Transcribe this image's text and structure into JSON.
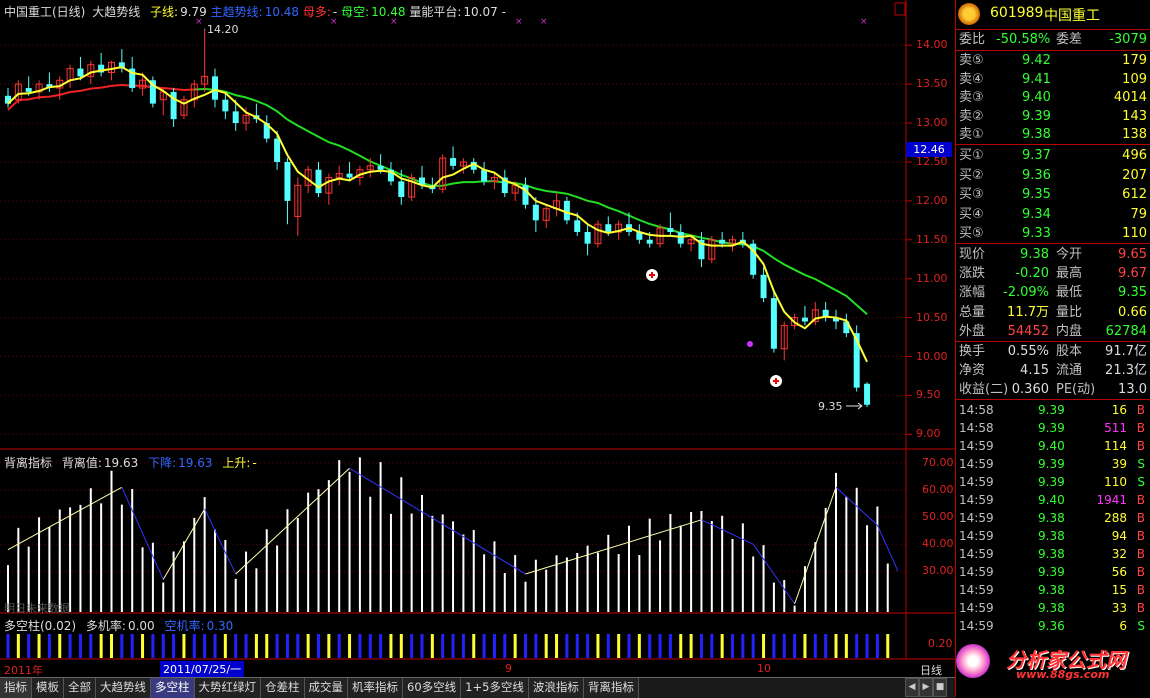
{
  "header": {
    "title": "中国重工(日线)",
    "indicator": "大趋势线",
    "sub_label": "子线:",
    "sub_val": "9.79",
    "main_label": "主趋势线:",
    "main_val": "10.48",
    "mother_label": "母多:",
    "mother_val": "-",
    "mokong_label": "母空:",
    "mokong_val": "10.48",
    "power_label": "量能平台:",
    "power_val": "10.07",
    "power_extra": "-"
  },
  "price_axis": [
    "14.00",
    "13.50",
    "13.00",
    "12.50",
    "12.00",
    "11.50",
    "11.00",
    "10.50",
    "10.00",
    "9.50",
    "9.00"
  ],
  "price_marker": "12.46",
  "high_label": "14.20",
  "low_label": "9.35",
  "sub_header": {
    "name": "背离指标",
    "val_label": "背离值:",
    "val": "19.63",
    "down_label": "下降:",
    "down_val": "19.63",
    "up_label": "上升:",
    "up_val": "-"
  },
  "sub_axis": [
    "70.00",
    "60.00",
    "50.00",
    "40.00",
    "30.00"
  ],
  "sub_watermark": "明日未来数据",
  "dk_header": {
    "name": "多空柱(0.02)",
    "duo_label": "多机率:",
    "duo_val": "0.00",
    "kong_label": "空机率:",
    "kong_val": "0.30"
  },
  "dk_axis": "0.20",
  "date_axis": {
    "year": "2011年",
    "cursor": "2011/07/25/一",
    "m9": "9",
    "m10": "10",
    "period": "日线"
  },
  "tabs": [
    "指标",
    "模板",
    "全部",
    "大趋势线",
    "多空柱",
    "大势红绿灯",
    "仓差柱",
    "成交量",
    "机率指标",
    "60多空线",
    "1+5多空线",
    "波浪指标",
    "背离指标"
  ],
  "active_tab": "多空柱",
  "quote": {
    "code": "601989",
    "name": "中国重工",
    "weibi_label": "委比",
    "weibi": "-50.58%",
    "weicha_label": "委差",
    "weicha": "-3079",
    "asks": [
      {
        "label": "卖⑤",
        "price": "9.42",
        "vol": "179"
      },
      {
        "label": "卖④",
        "price": "9.41",
        "vol": "109"
      },
      {
        "label": "卖③",
        "price": "9.40",
        "vol": "4014"
      },
      {
        "label": "卖②",
        "price": "9.39",
        "vol": "143"
      },
      {
        "label": "卖①",
        "price": "9.38",
        "vol": "138"
      }
    ],
    "bids": [
      {
        "label": "买①",
        "price": "9.37",
        "vol": "496"
      },
      {
        "label": "买②",
        "price": "9.36",
        "vol": "207"
      },
      {
        "label": "买③",
        "price": "9.35",
        "vol": "612"
      },
      {
        "label": "买④",
        "price": "9.34",
        "vol": "79"
      },
      {
        "label": "买⑤",
        "price": "9.33",
        "vol": "110"
      }
    ],
    "stats": [
      {
        "l1": "现价",
        "v1": "9.38",
        "c1": "#3f3",
        "l2": "今开",
        "v2": "9.65",
        "c2": "#f44"
      },
      {
        "l1": "涨跌",
        "v1": "-0.20",
        "c1": "#3f3",
        "l2": "最高",
        "v2": "9.67",
        "c2": "#f44"
      },
      {
        "l1": "涨幅",
        "v1": "-2.09%",
        "c1": "#3f3",
        "l2": "最低",
        "v2": "9.35",
        "c2": "#3f3"
      },
      {
        "l1": "总量",
        "v1": "11.7万",
        "c1": "#ff3",
        "l2": "量比",
        "v2": "0.66",
        "c2": "#ff3"
      },
      {
        "l1": "外盘",
        "v1": "54452",
        "c1": "#f44",
        "l2": "内盘",
        "v2": "62784",
        "c2": "#3f3"
      }
    ],
    "stats2": [
      {
        "l1": "换手",
        "v1": "0.55%",
        "l2": "股本",
        "v2": "91.7亿"
      },
      {
        "l1": "净资",
        "v1": "4.15",
        "l2": "流通",
        "v2": "21.3亿"
      },
      {
        "l1": "收益(二)",
        "v1": "0.360",
        "l2": "PE(动)",
        "v2": "13.0"
      }
    ],
    "ticks": [
      {
        "t": "14:58",
        "p": "9.39",
        "v": "16",
        "vc": "#ff3",
        "s": "B"
      },
      {
        "t": "14:58",
        "p": "9.39",
        "v": "511",
        "vc": "#f3f",
        "s": "B"
      },
      {
        "t": "14:59",
        "p": "9.40",
        "v": "114",
        "vc": "#ff3",
        "s": "B"
      },
      {
        "t": "14:59",
        "p": "9.39",
        "v": "39",
        "vc": "#ff3",
        "s": "S"
      },
      {
        "t": "14:59",
        "p": "9.39",
        "v": "110",
        "vc": "#ff3",
        "s": "S"
      },
      {
        "t": "14:59",
        "p": "9.40",
        "v": "1941",
        "vc": "#f3f",
        "s": "B"
      },
      {
        "t": "14:59",
        "p": "9.38",
        "v": "288",
        "vc": "#ff3",
        "s": "B"
      },
      {
        "t": "14:59",
        "p": "9.38",
        "v": "94",
        "vc": "#ff3",
        "s": "B"
      },
      {
        "t": "14:59",
        "p": "9.38",
        "v": "32",
        "vc": "#ff3",
        "s": "B"
      },
      {
        "t": "14:59",
        "p": "9.39",
        "v": "56",
        "vc": "#ff3",
        "s": "B"
      },
      {
        "t": "14:59",
        "p": "9.38",
        "v": "15",
        "vc": "#ff3",
        "s": "B"
      },
      {
        "t": "14:59",
        "p": "9.38",
        "v": "33",
        "vc": "#ff3",
        "s": "B"
      },
      {
        "t": "14:59",
        "p": "9.36",
        "v": "6",
        "vc": "#ff3",
        "s": "S"
      }
    ]
  },
  "watermark": {
    "brand": "分析家公式网",
    "url": "www.88gs.com"
  },
  "chart_data": {
    "type": "candlestick",
    "price_range": [
      8.85,
      14.35
    ],
    "candles": [
      [
        13.35,
        13.45,
        13.2,
        13.25
      ],
      [
        13.3,
        13.55,
        13.25,
        13.5
      ],
      [
        13.45,
        13.6,
        13.35,
        13.4
      ],
      [
        13.4,
        13.55,
        13.3,
        13.5
      ],
      [
        13.5,
        13.65,
        13.4,
        13.45
      ],
      [
        13.45,
        13.6,
        13.3,
        13.55
      ],
      [
        13.55,
        13.75,
        13.45,
        13.7
      ],
      [
        13.7,
        13.85,
        13.55,
        13.6
      ],
      [
        13.6,
        13.8,
        13.5,
        13.75
      ],
      [
        13.75,
        13.9,
        13.6,
        13.65
      ],
      [
        13.65,
        13.8,
        13.55,
        13.78
      ],
      [
        13.78,
        13.95,
        13.65,
        13.7
      ],
      [
        13.7,
        13.85,
        13.4,
        13.45
      ],
      [
        13.45,
        13.65,
        13.35,
        13.55
      ],
      [
        13.55,
        13.6,
        13.2,
        13.25
      ],
      [
        13.3,
        13.45,
        13.1,
        13.4
      ],
      [
        13.4,
        13.45,
        12.95,
        13.05
      ],
      [
        13.1,
        13.35,
        13.05,
        13.3
      ],
      [
        13.3,
        13.55,
        13.2,
        13.5
      ],
      [
        13.5,
        14.2,
        13.4,
        13.6
      ],
      [
        13.6,
        13.7,
        13.2,
        13.3
      ],
      [
        13.3,
        13.4,
        13.05,
        13.15
      ],
      [
        13.15,
        13.3,
        12.9,
        13.0
      ],
      [
        13.0,
        13.2,
        12.9,
        13.1
      ],
      [
        13.1,
        13.25,
        13.0,
        13.05
      ],
      [
        13.0,
        13.1,
        12.75,
        12.8
      ],
      [
        12.8,
        12.9,
        12.4,
        12.5
      ],
      [
        12.5,
        12.55,
        11.7,
        12.0
      ],
      [
        11.8,
        12.3,
        11.55,
        12.2
      ],
      [
        12.2,
        12.45,
        12.1,
        12.4
      ],
      [
        12.4,
        12.5,
        12.05,
        12.1
      ],
      [
        12.1,
        12.35,
        11.95,
        12.3
      ],
      [
        12.3,
        12.45,
        12.2,
        12.35
      ],
      [
        12.35,
        12.5,
        12.25,
        12.3
      ],
      [
        12.3,
        12.45,
        12.2,
        12.4
      ],
      [
        12.4,
        12.55,
        12.3,
        12.45
      ],
      [
        12.45,
        12.6,
        12.35,
        12.4
      ],
      [
        12.4,
        12.5,
        12.2,
        12.25
      ],
      [
        12.25,
        12.4,
        11.95,
        12.05
      ],
      [
        12.05,
        12.35,
        12.0,
        12.3
      ],
      [
        12.3,
        12.45,
        12.15,
        12.2
      ],
      [
        12.2,
        12.3,
        12.1,
        12.15
      ],
      [
        12.15,
        12.6,
        12.1,
        12.55
      ],
      [
        12.55,
        12.7,
        12.4,
        12.45
      ],
      [
        12.45,
        12.55,
        12.35,
        12.5
      ],
      [
        12.5,
        12.55,
        12.35,
        12.4
      ],
      [
        12.4,
        12.5,
        12.2,
        12.25
      ],
      [
        12.25,
        12.35,
        12.15,
        12.3
      ],
      [
        12.3,
        12.4,
        12.05,
        12.1
      ],
      [
        12.1,
        12.25,
        12.0,
        12.2
      ],
      [
        12.2,
        12.3,
        11.9,
        11.95
      ],
      [
        11.95,
        12.05,
        11.6,
        11.75
      ],
      [
        11.75,
        11.95,
        11.65,
        11.9
      ],
      [
        11.9,
        12.1,
        11.8,
        12.0
      ],
      [
        12.0,
        12.05,
        11.7,
        11.75
      ],
      [
        11.75,
        11.85,
        11.55,
        11.6
      ],
      [
        11.6,
        11.7,
        11.3,
        11.45
      ],
      [
        11.45,
        11.75,
        11.4,
        11.7
      ],
      [
        11.7,
        11.8,
        11.55,
        11.6
      ],
      [
        11.6,
        11.75,
        11.5,
        11.7
      ],
      [
        11.7,
        11.85,
        11.55,
        11.6
      ],
      [
        11.6,
        11.7,
        11.45,
        11.5
      ],
      [
        11.5,
        11.6,
        11.4,
        11.45
      ],
      [
        11.45,
        11.7,
        11.4,
        11.65
      ],
      [
        11.65,
        11.85,
        11.55,
        11.6
      ],
      [
        11.6,
        11.7,
        11.4,
        11.45
      ],
      [
        11.45,
        11.55,
        11.35,
        11.5
      ],
      [
        11.5,
        11.6,
        11.15,
        11.25
      ],
      [
        11.25,
        11.55,
        11.2,
        11.5
      ],
      [
        11.5,
        11.6,
        11.4,
        11.45
      ],
      [
        11.45,
        11.55,
        11.35,
        11.5
      ],
      [
        11.5,
        11.6,
        11.4,
        11.45
      ],
      [
        11.45,
        11.5,
        11.0,
        11.05
      ],
      [
        11.05,
        11.15,
        10.7,
        10.75
      ],
      [
        10.75,
        10.85,
        10.05,
        10.1
      ],
      [
        10.1,
        10.45,
        9.95,
        10.4
      ],
      [
        10.4,
        10.55,
        10.35,
        10.5
      ],
      [
        10.5,
        10.65,
        10.4,
        10.45
      ],
      [
        10.45,
        10.7,
        10.4,
        10.6
      ],
      [
        10.6,
        10.7,
        10.45,
        10.5
      ],
      [
        10.5,
        10.6,
        10.35,
        10.45
      ],
      [
        10.45,
        10.55,
        10.25,
        10.3
      ],
      [
        10.3,
        10.4,
        9.55,
        9.6
      ],
      [
        9.65,
        9.67,
        9.35,
        9.38
      ]
    ]
  }
}
